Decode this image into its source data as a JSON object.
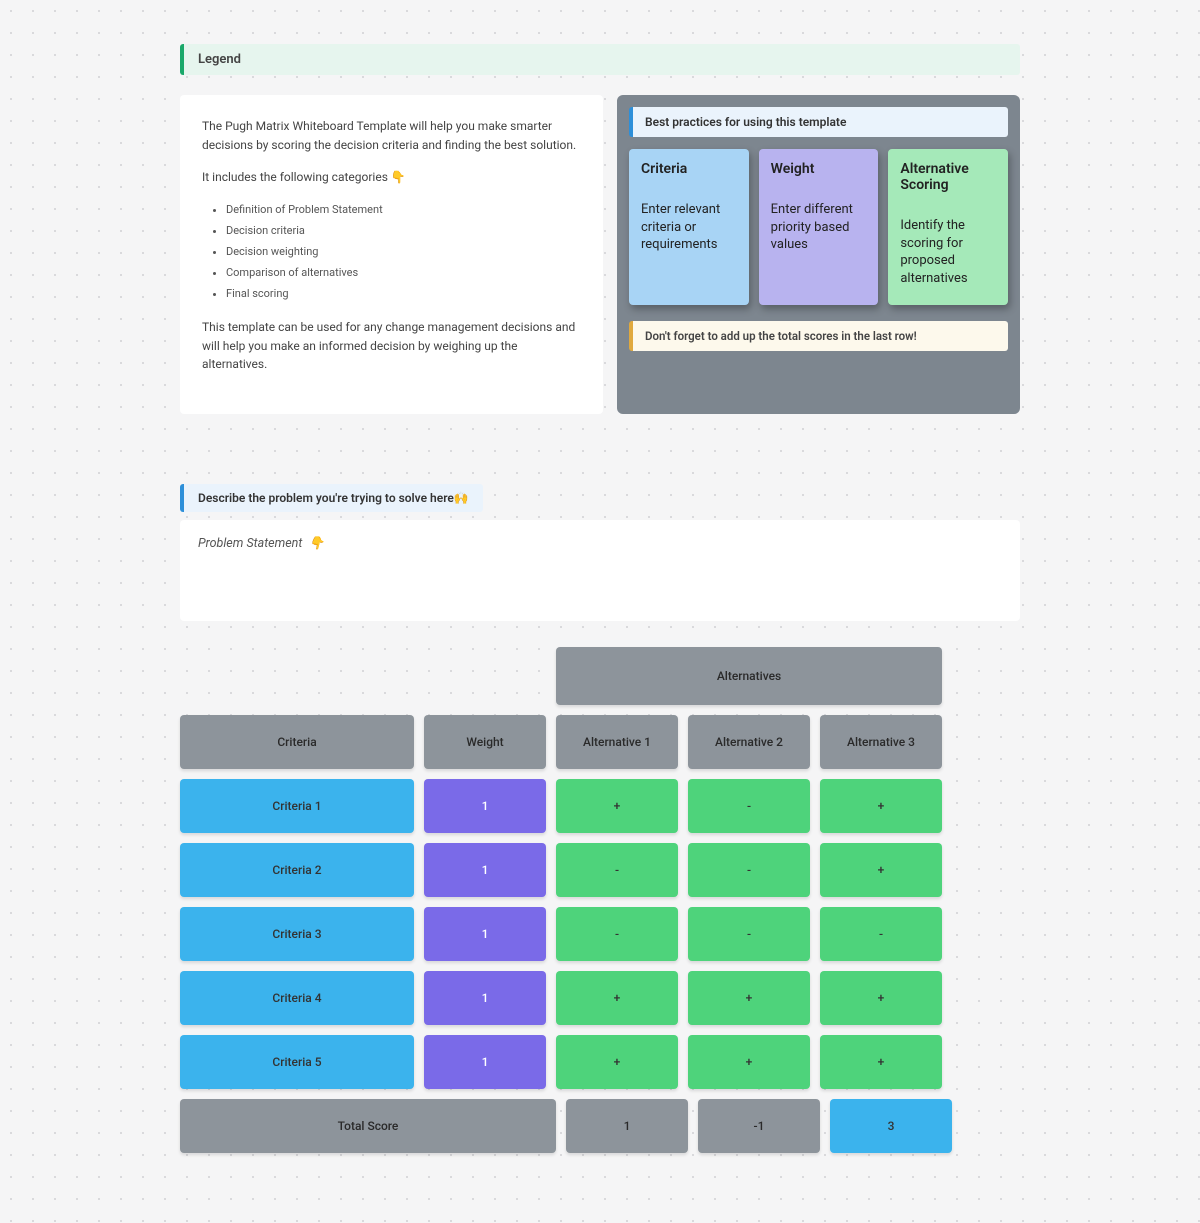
{
  "legend": {
    "title": "Legend"
  },
  "description": {
    "p1": "The Pugh Matrix Whiteboard Template will help you make smarter decisions by scoring the decision criteria and finding the best solution.",
    "p2_prefix": "It includes the following categories ",
    "p2_emoji": "👇",
    "bullets": [
      "Definition of Problem Statement",
      "Decision criteria",
      "Decision weighting",
      "Comparison of alternatives",
      "Final scoring"
    ],
    "p3": "This template can be used for any change management decisions and will help you make an informed decision by weighing up the alternatives."
  },
  "best_practices": {
    "header": "Best practices for using this template",
    "stickies": [
      {
        "title": "Criteria",
        "body": "Enter relevant criteria or requirements"
      },
      {
        "title": "Weight",
        "body": "Enter different priority based values"
      },
      {
        "title": "Alternative Scoring",
        "body": "Identify the scoring for proposed alternatives"
      }
    ],
    "footer": "Don't forget to add up the total scores in the last row!"
  },
  "problem": {
    "label": "Describe the problem you're trying to solve here",
    "label_emoji": "🙌",
    "placeholder": "Problem Statement",
    "placeholder_emoji": "👇"
  },
  "matrix": {
    "alternatives_header": "Alternatives",
    "col_headers": {
      "criteria": "Criteria",
      "weight": "Weight",
      "alt1": "Alternative 1",
      "alt2": "Alternative 2",
      "alt3": "Alternative 3"
    },
    "rows": [
      {
        "criteria": "Criteria 1",
        "weight": "1",
        "alt1": "+",
        "alt2": "-",
        "alt3": "+"
      },
      {
        "criteria": "Criteria 2",
        "weight": "1",
        "alt1": "-",
        "alt2": "-",
        "alt3": "+"
      },
      {
        "criteria": "Criteria 3",
        "weight": "1",
        "alt1": "-",
        "alt2": "-",
        "alt3": "-"
      },
      {
        "criteria": "Criteria 4",
        "weight": "1",
        "alt1": "+",
        "alt2": "+",
        "alt3": "+"
      },
      {
        "criteria": "Criteria 5",
        "weight": "1",
        "alt1": "+",
        "alt2": "+",
        "alt3": "+"
      }
    ],
    "total": {
      "label": "Total Score",
      "alt1": "1",
      "alt2": "-1",
      "alt3": "3"
    }
  }
}
